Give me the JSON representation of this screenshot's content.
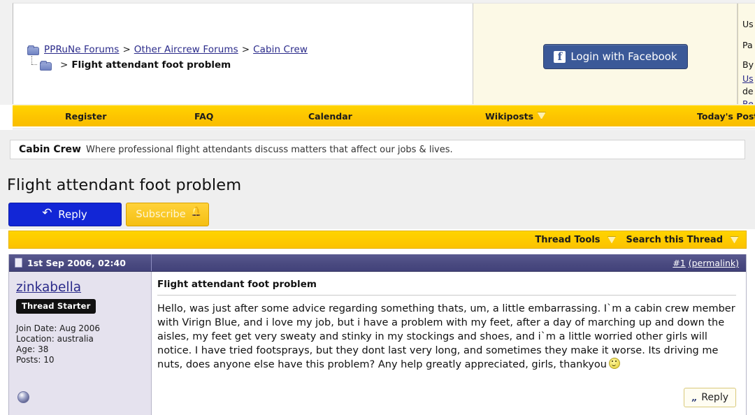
{
  "breadcrumb": {
    "links": [
      {
        "label": "PPRuNe Forums"
      },
      {
        "label": "Other Aircrew Forums"
      },
      {
        "label": "Cabin Crew"
      }
    ],
    "separator": ">",
    "current": "Flight attendant foot problem"
  },
  "login": {
    "facebook_button": "Login with Facebook",
    "facebook_glyph": "f",
    "facebook_color": "#3b5998",
    "form_rows": [
      "Us",
      "Pa",
      "By",
      "Us",
      "de",
      "Re"
    ]
  },
  "navbar": {
    "items": [
      {
        "label": "Register",
        "caret": false
      },
      {
        "label": "FAQ",
        "caret": false
      },
      {
        "label": "Calendar",
        "caret": false
      },
      {
        "label": "Wikiposts",
        "caret": true
      },
      {
        "label": "Today's Posts",
        "caret": false
      }
    ],
    "background": "#fdc500"
  },
  "forum": {
    "name": "Cabin Crew",
    "description": "Where professional flight attendants discuss matters that affect our jobs & lives."
  },
  "thread": {
    "title": "Flight attendant foot problem",
    "reply_button": "Reply",
    "subscribe_button": "Subscribe",
    "reply_color": "#1226d6",
    "subscribe_color": "#f5bf12"
  },
  "tools": {
    "thread_tools": "Thread Tools",
    "search_thread": "Search this Thread"
  },
  "post": {
    "date": "1st Sep 2006, 02:40",
    "number": "#1",
    "permalink": "(permalink)",
    "subject": "Flight attendant foot problem",
    "body": "Hello, was just after some advice regarding something thats, um, a little embarrassing.\nI`m a cabin crew member with Virign Blue, and i love my job, but i have a problem with my feet, after a day of marching up and down the aisles, my feet get very sweaty and stinky in my stockings and shoes, and i`m a little worried other girls will notice. I have tried footsprays, but they dont last very long, and sometimes they make it worse. Its driving me nuts, does anyone else have this problem? Any help greatly appreciated, girls, thankyou",
    "quote_reply_button": "Reply",
    "header_color": "#4a4a80",
    "user": {
      "name": "zinkabella",
      "badge": "Thread Starter",
      "join_date": "Join Date: Aug 2006",
      "location": "Location: australia",
      "age": "Age: 38",
      "posts": "Posts: 10",
      "panel_color": "#e5e2ee"
    }
  }
}
